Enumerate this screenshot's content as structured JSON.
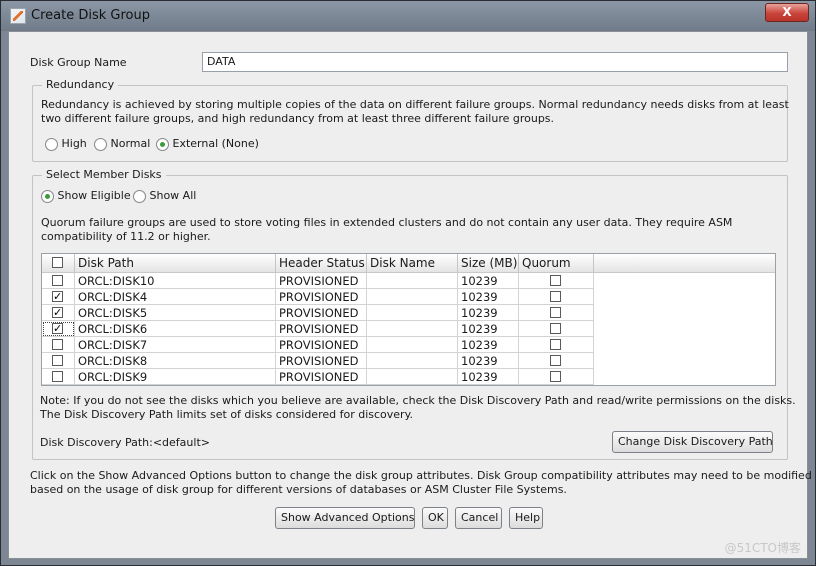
{
  "window": {
    "title": "Create Disk Group",
    "close_label": "X"
  },
  "disk_group_name": {
    "label": "Disk Group Name",
    "value": "DATA"
  },
  "redundancy": {
    "group_title": "Redundancy",
    "description_line1": "Redundancy is achieved by storing multiple copies of the data on different failure groups. Normal redundancy needs disks from at least",
    "description_line2": "two different failure groups, and high redundancy from at least three different failure groups.",
    "options": [
      {
        "label": "High",
        "selected": false
      },
      {
        "label": "Normal",
        "selected": false
      },
      {
        "label": "External (None)",
        "selected": true
      }
    ]
  },
  "member_disks": {
    "group_title": "Select Member Disks",
    "filter_options": [
      {
        "label": "Show Eligible",
        "selected": true
      },
      {
        "label": "Show All",
        "selected": false
      }
    ],
    "quorum_note_line1": "Quorum failure groups are used to store voting files in extended clusters and do not contain any user data. They require ASM",
    "quorum_note_line2": "compatibility of 11.2 or higher.",
    "table": {
      "columns": [
        "Disk Path",
        "Header Status",
        "Disk Name",
        "Size (MB)",
        "Quorum"
      ],
      "rows": [
        {
          "selected": false,
          "path": "ORCL:DISK10",
          "status": "PROVISIONED",
          "name": "",
          "size": "10239",
          "quorum": false
        },
        {
          "selected": true,
          "path": "ORCL:DISK4",
          "status": "PROVISIONED",
          "name": "",
          "size": "10239",
          "quorum": false
        },
        {
          "selected": true,
          "path": "ORCL:DISK5",
          "status": "PROVISIONED",
          "name": "",
          "size": "10239",
          "quorum": false
        },
        {
          "selected": true,
          "path": "ORCL:DISK6",
          "status": "PROVISIONED",
          "name": "",
          "size": "10239",
          "quorum": false
        },
        {
          "selected": false,
          "path": "ORCL:DISK7",
          "status": "PROVISIONED",
          "name": "",
          "size": "10239",
          "quorum": false
        },
        {
          "selected": false,
          "path": "ORCL:DISK8",
          "status": "PROVISIONED",
          "name": "",
          "size": "10239",
          "quorum": false
        },
        {
          "selected": false,
          "path": "ORCL:DISK9",
          "status": "PROVISIONED",
          "name": "",
          "size": "10239",
          "quorum": false
        }
      ]
    },
    "discovery_note_line1": "Note: If you do not see the disks which you believe are available, check the Disk Discovery Path and read/write permissions on the disks.",
    "discovery_note_line2": "The Disk Discovery Path limits set of disks considered for discovery.",
    "discovery_path_label": "Disk Discovery Path:<default>",
    "change_path_button": "Change Disk Discovery Path"
  },
  "advanced_note_line1": "Click on the Show Advanced Options button to change the disk group attributes. Disk Group compatibility attributes may need to be modified",
  "advanced_note_line2": "based on the usage of disk group for different versions of databases or ASM Cluster File Systems.",
  "buttons": {
    "advanced": "Show Advanced Options",
    "ok": "OK",
    "cancel": "Cancel",
    "help": "Help"
  },
  "watermark": "@51CTO博客",
  "colors": {
    "titlebar": "#7d8794",
    "close": "#c9443a",
    "radio_selected": "#3a9b3a"
  }
}
